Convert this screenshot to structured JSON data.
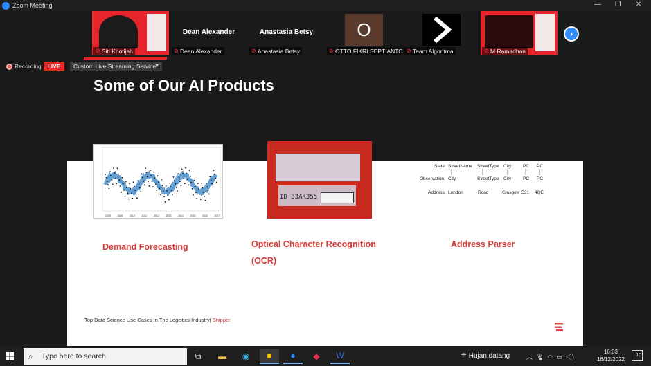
{
  "window": {
    "title": "Zoom Meeting",
    "controls": [
      "—",
      "❐",
      "✕"
    ]
  },
  "gallery": {
    "participants": [
      {
        "name": "Siti Khotijah",
        "type": "video-banner",
        "muted": true
      },
      {
        "name": "Dean Alexander",
        "display_name": "Dean Alexander",
        "type": "name-only",
        "muted": true
      },
      {
        "name": "Anastasia Betsy",
        "display_name": "Anastasia Betsy",
        "type": "name-only",
        "muted": true
      },
      {
        "name": "OTTO FIKRI SEPTIANTO",
        "avatar_letter": "O",
        "type": "avatar",
        "muted": true
      },
      {
        "name": "Team Algoritma",
        "type": "logo",
        "muted": true
      },
      {
        "name": "M Ramadhan",
        "type": "video-banner",
        "muted": true
      }
    ],
    "next_icon": "chevron-right-icon"
  },
  "recording": {
    "label": "Recording",
    "live_badge": "LIVE",
    "stream_service": "Custom Live Streaming Service"
  },
  "slide": {
    "title": "Some of Our AI Products",
    "products": [
      {
        "label": "Demand Forecasting"
      },
      {
        "label_line1": "Optical Character Recognition",
        "label_line2": "(OCR)"
      },
      {
        "label": "Address Parser"
      }
    ],
    "ocr_code": "ID 33AK355",
    "parser": {
      "row1": [
        "State:",
        "StreetName",
        "StreetType",
        "City",
        "PC",
        "PC"
      ],
      "row2": [
        "Observation:",
        "City",
        "StreetType",
        "City",
        "PC",
        "PC"
      ],
      "row3": [
        "Address:",
        "London",
        "Road",
        "Glasgow",
        "G31",
        "4QE"
      ]
    },
    "chart_years": [
      "2005",
      "2006",
      "2010",
      "2011",
      "2012",
      "2013",
      "2014",
      "2015",
      "2016",
      "2017"
    ],
    "source_text": "Top Data Science Use Cases In The Logistics Industry|",
    "source_link": "Shipper"
  },
  "taskbar": {
    "search_placeholder": "Type here to search",
    "weather": "Hujan datang",
    "time": "16:03",
    "date": "16/12/2022",
    "notification_count": "10",
    "accent": "#2d8cff"
  }
}
